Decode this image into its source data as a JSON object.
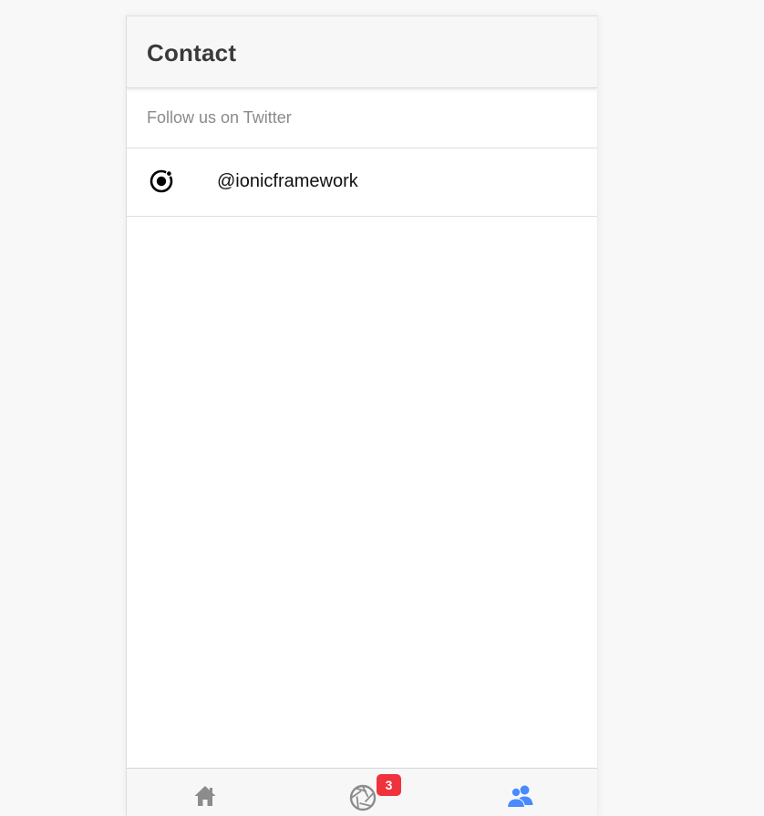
{
  "toolbar": {
    "title": "Contact"
  },
  "list": {
    "header": "Follow us on Twitter",
    "items": [
      {
        "label": "@ionicframework",
        "icon": "ionic-icon"
      }
    ]
  },
  "tabs": [
    {
      "name": "home",
      "icon": "home-icon",
      "selected": false
    },
    {
      "name": "about",
      "icon": "aperture-icon",
      "selected": false,
      "badge": "3"
    },
    {
      "name": "contact",
      "icon": "contacts-icon",
      "selected": true
    }
  ],
  "colors": {
    "accent": "#488aff",
    "tab_inactive": "#8c8c8c",
    "badge": "#f0323c",
    "toolbar_bg": "#f7f7f7"
  }
}
